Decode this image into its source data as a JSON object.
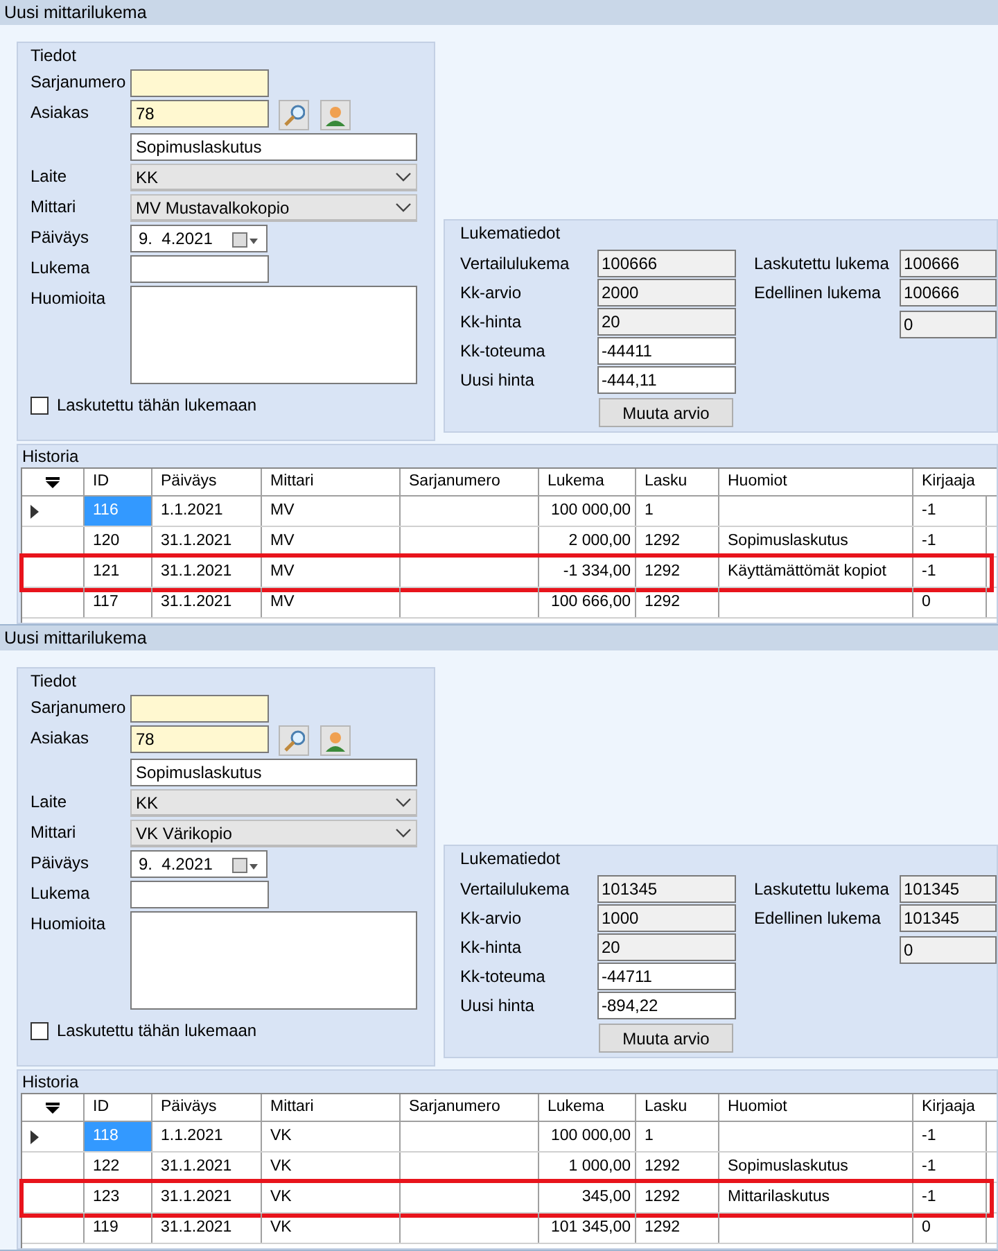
{
  "windows": [
    {
      "title": "Uusi mittarilukema",
      "tiedot": {
        "title": "Tiedot",
        "rows": [
          {
            "label": "Sarjanumero",
            "kind": "text",
            "required": true
          },
          {
            "label": "Asiakas",
            "kind": "lookup",
            "value": "78",
            "required": true
          },
          {
            "kind": "longtext",
            "value": "Sopimuslaskutus",
            "required": false
          },
          {
            "label": "Laite",
            "kind": "combo",
            "value": "KK"
          },
          {
            "label": "Mittari",
            "kind": "combo",
            "value": "MV  Mustavalkokopio"
          },
          {
            "label": "Päiväys",
            "kind": "date",
            "value": "9.  4.2021"
          },
          {
            "label": "Lukema",
            "kind": "text",
            "required": false
          },
          {
            "label": "Huomioita",
            "kind": "memo"
          }
        ],
        "checkbox": {
          "label": "Laskutettu tähän lukemaan",
          "checked": false
        }
      },
      "lukematiedot": {
        "title": "Lukematiedot",
        "left": [
          {
            "label": "Vertailulukema",
            "value": "100666",
            "readonly": true
          },
          {
            "label": "Kk-arvio",
            "value": "2000",
            "readonly": true
          },
          {
            "label": "Kk-hinta",
            "value": "20",
            "readonly": true
          },
          {
            "label": "Kk-toteuma",
            "value": "-44411",
            "readonly": false
          },
          {
            "label": "Uusi hinta",
            "value": "-444,11",
            "readonly": false
          }
        ],
        "right": [
          {
            "label": "Laskutettu lukema",
            "value": "100666"
          },
          {
            "label": "Edellinen lukema",
            "value": "100666"
          },
          {
            "value": "0"
          }
        ],
        "button": "Muuta arvio"
      },
      "historia": {
        "title": "Historia",
        "columns": [
          "ID",
          "Päiväys",
          "Mittari",
          "Sarjanumero",
          "Lukema",
          "Lasku",
          "Huomiot",
          "Kirjaaja"
        ],
        "rows": [
          {
            "cells": [
              "116",
              "1.1.2021",
              "MV",
              "",
              "100 000,00",
              "1",
              "",
              "-1"
            ],
            "selected": true,
            "highlighted": false
          },
          {
            "cells": [
              "120",
              "31.1.2021",
              "MV",
              "",
              "2 000,00",
              "1292",
              "Sopimuslaskutus",
              "-1"
            ],
            "selected": false,
            "highlighted": false
          },
          {
            "cells": [
              "121",
              "31.1.2021",
              "MV",
              "",
              "-1 334,00",
              "1292",
              "Käyttämättömät kopiot",
              "-1"
            ],
            "selected": false,
            "highlighted": true
          },
          {
            "cells": [
              "117",
              "31.1.2021",
              "MV",
              "",
              "100 666,00",
              "1292",
              "",
              "0"
            ],
            "selected": false,
            "highlighted": false
          }
        ]
      }
    },
    {
      "title": "Uusi mittarilukema",
      "tiedot": {
        "title": "Tiedot",
        "rows": [
          {
            "label": "Sarjanumero",
            "kind": "text",
            "required": true
          },
          {
            "label": "Asiakas",
            "kind": "lookup",
            "value": "78",
            "required": true
          },
          {
            "kind": "longtext",
            "value": "Sopimuslaskutus",
            "required": false
          },
          {
            "label": "Laite",
            "kind": "combo",
            "value": "KK"
          },
          {
            "label": "Mittari",
            "kind": "combo",
            "value": "VK  Värikopio"
          },
          {
            "label": "Päiväys",
            "kind": "date",
            "value": "9.  4.2021"
          },
          {
            "label": "Lukema",
            "kind": "text",
            "required": false
          },
          {
            "label": "Huomioita",
            "kind": "memo"
          }
        ],
        "checkbox": {
          "label": "Laskutettu tähän lukemaan",
          "checked": false
        }
      },
      "lukematiedot": {
        "title": "Lukematiedot",
        "left": [
          {
            "label": "Vertailulukema",
            "value": "101345",
            "readonly": true
          },
          {
            "label": "Kk-arvio",
            "value": "1000",
            "readonly": true
          },
          {
            "label": "Kk-hinta",
            "value": "20",
            "readonly": true
          },
          {
            "label": "Kk-toteuma",
            "value": "-44711",
            "readonly": false
          },
          {
            "label": "Uusi hinta",
            "value": "-894,22",
            "readonly": false
          }
        ],
        "right": [
          {
            "label": "Laskutettu lukema",
            "value": "101345"
          },
          {
            "label": "Edellinen lukema",
            "value": "101345"
          },
          {
            "value": "0"
          }
        ],
        "button": "Muuta arvio"
      },
      "historia": {
        "title": "Historia",
        "columns": [
          "ID",
          "Päiväys",
          "Mittari",
          "Sarjanumero",
          "Lukema",
          "Lasku",
          "Huomiot",
          "Kirjaaja"
        ],
        "rows": [
          {
            "cells": [
              "118",
              "1.1.2021",
              "VK",
              "",
              "100 000,00",
              "1",
              "",
              "-1"
            ],
            "selected": true,
            "highlighted": false
          },
          {
            "cells": [
              "122",
              "31.1.2021",
              "VK",
              "",
              "1 000,00",
              "1292",
              "Sopimuslaskutus",
              "-1"
            ],
            "selected": false,
            "highlighted": false
          },
          {
            "cells": [
              "123",
              "31.1.2021",
              "VK",
              "",
              "345,00",
              "1292",
              "Mittarilaskutus",
              "-1"
            ],
            "selected": false,
            "highlighted": true
          },
          {
            "cells": [
              "119",
              "31.1.2021",
              "VK",
              "",
              "101 345,00",
              "1292",
              "",
              "0"
            ],
            "selected": false,
            "highlighted": false
          }
        ]
      }
    }
  ]
}
